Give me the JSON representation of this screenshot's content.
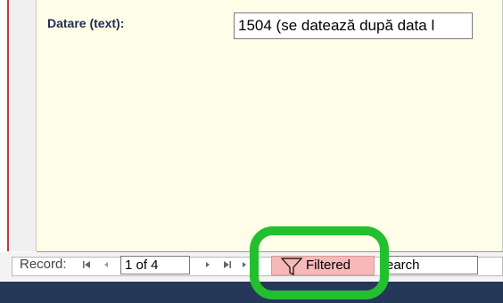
{
  "form": {
    "field_label": "Datare (text):",
    "field_value": "1504 (se datează după data l"
  },
  "nav": {
    "record_label": "Record:",
    "first_icon": "first-record-icon",
    "prev_icon": "previous-record-icon",
    "record_value": "1 of 4",
    "next_icon": "next-record-icon",
    "last_icon": "last-record-icon",
    "filtered_label": "Filtered",
    "filter_icon": "funnel-icon",
    "search_value": "earch"
  },
  "colors": {
    "form_bg": "#fefde8",
    "filtered_bg": "#f6b9b7",
    "highlight": "#22c02f",
    "status_bar": "#26385a"
  }
}
